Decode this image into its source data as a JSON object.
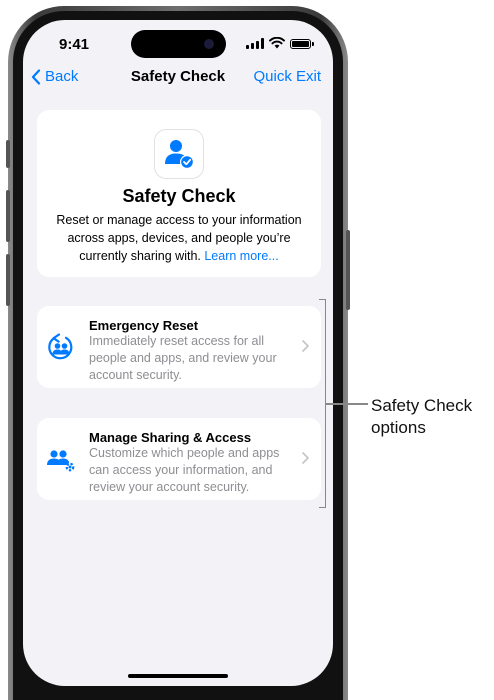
{
  "status_bar": {
    "time": "9:41"
  },
  "nav": {
    "back_label": "Back",
    "title": "Safety Check",
    "quick_exit_label": "Quick Exit"
  },
  "header": {
    "icon": "person-shield-icon",
    "title": "Safety Check",
    "description": "Reset or manage access to your information across apps, devices, and people you’re currently sharing with.",
    "learn_more": "Learn more..."
  },
  "options": [
    {
      "icon": "emergency-reset-icon",
      "title": "Emergency Reset",
      "description": "Immediately reset access for all people and apps, and review your account security."
    },
    {
      "icon": "manage-sharing-icon",
      "title": "Manage Sharing & Access",
      "description": "Customize which people and apps can access your information, and review your account security."
    }
  ],
  "callout": {
    "line1": "Safety Check",
    "line2": "options"
  },
  "colors": {
    "accent": "#007aff",
    "background": "#f2f2f7",
    "card": "#ffffff",
    "secondary_text": "#8e8e93"
  }
}
